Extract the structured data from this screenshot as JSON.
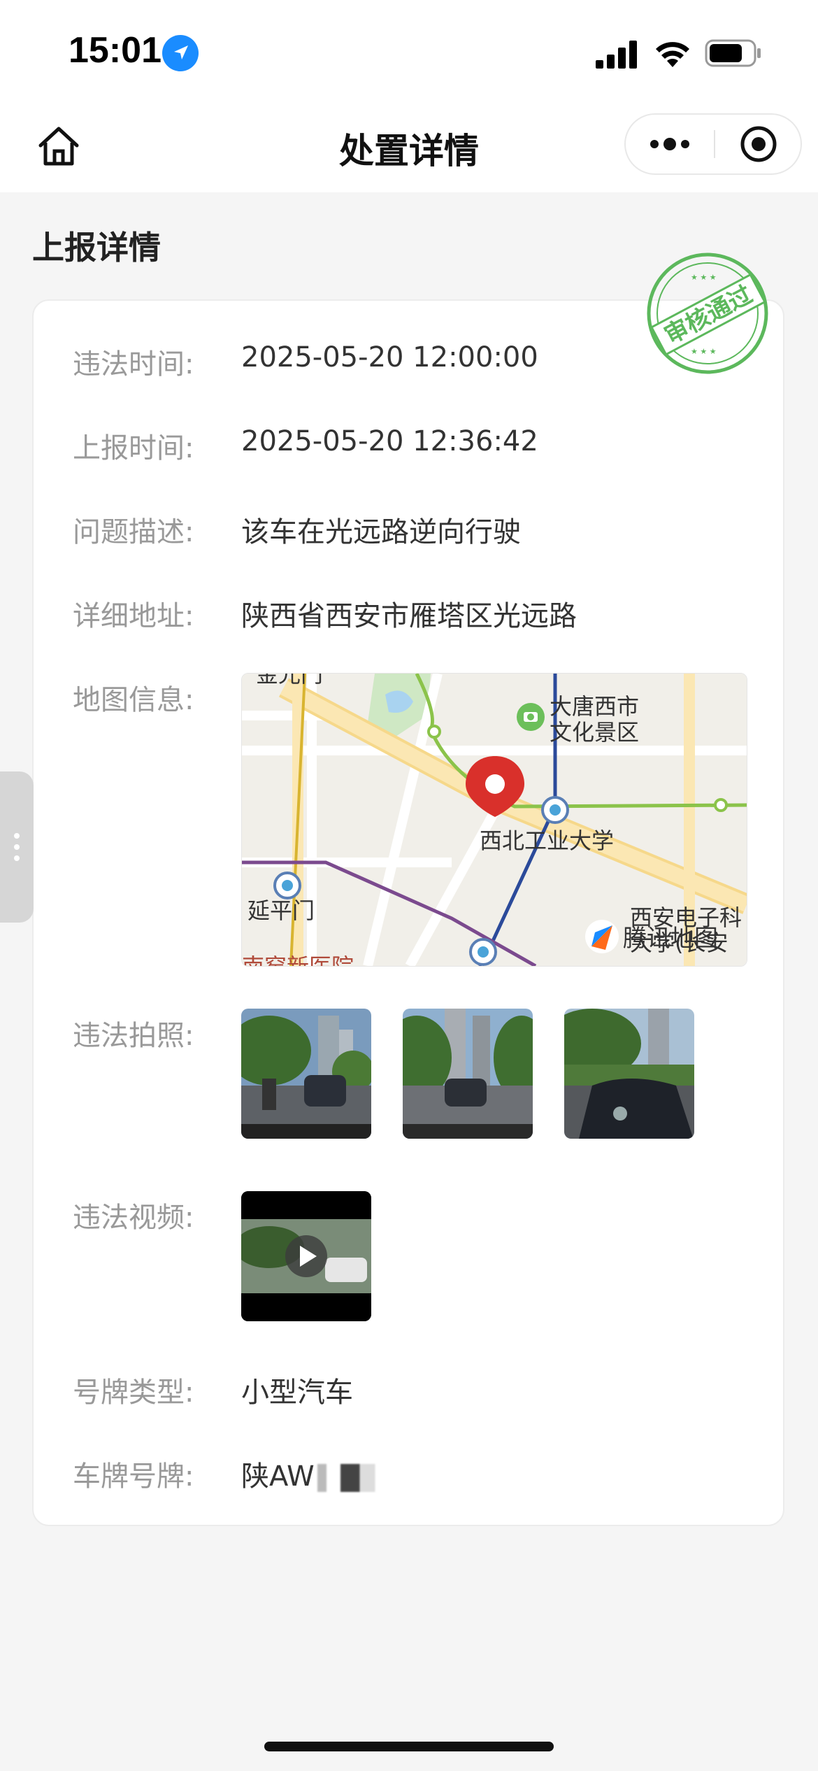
{
  "status_bar": {
    "time": "15:01"
  },
  "nav": {
    "title": "处置详情"
  },
  "section": {
    "title": "上报详情"
  },
  "stamp": {
    "text": "审核通过",
    "color": "#4caf50"
  },
  "details": [
    {
      "label": "违法时间:",
      "value": "2025-05-20 12:00:00"
    },
    {
      "label": "上报时间:",
      "value": "2025-05-20 12:36:42"
    },
    {
      "label": "问题描述:",
      "value": "该车在光远路逆向行驶"
    },
    {
      "label": "详细地址:",
      "value": "陕西省西安市雁塔区光远路"
    },
    {
      "label": "地图信息:"
    },
    {
      "label": "违法拍照:"
    },
    {
      "label": "违法视频:"
    },
    {
      "label": "号牌类型:",
      "value": "小型汽车"
    },
    {
      "label": "车牌号牌:",
      "value": "陕AW"
    }
  ],
  "map": {
    "labels": {
      "poi_park": "大唐西市",
      "poi_park2": "文化景区",
      "univ": "西北工业大学",
      "gate": "延平门",
      "top_left": "金光门",
      "bottom_right": "西安电子科",
      "bottom_right2": "大学(长安",
      "bottom_left": "南窑新医院",
      "brand": "腾讯地图"
    }
  },
  "photos": [
    {
      "name": "photo-1"
    },
    {
      "name": "photo-2"
    },
    {
      "name": "photo-3"
    }
  ]
}
